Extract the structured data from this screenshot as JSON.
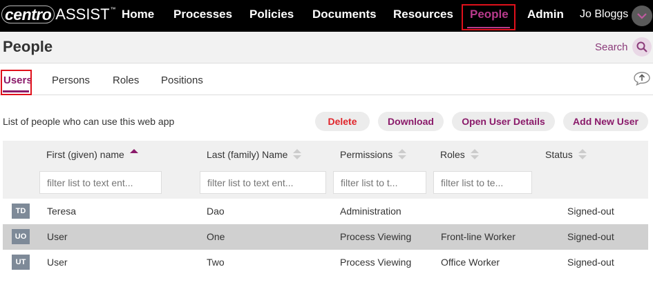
{
  "brand": {
    "logo_primary": "centro",
    "logo_secondary": "ASSIST",
    "logo_mark": "™"
  },
  "nav": {
    "items": [
      {
        "label": "Home"
      },
      {
        "label": "Processes"
      },
      {
        "label": "Policies"
      },
      {
        "label": "Documents"
      },
      {
        "label": "Resources"
      },
      {
        "label": "People"
      },
      {
        "label": "Admin"
      }
    ],
    "active": "People",
    "user_name": "Jo Bloggs",
    "user_menu_icon": "chevron-down-icon"
  },
  "header": {
    "title": "People",
    "search_label": "Search",
    "search_icon": "search-icon"
  },
  "tabs": [
    {
      "label": "Users"
    },
    {
      "label": "Persons"
    },
    {
      "label": "Roles"
    },
    {
      "label": "Positions"
    }
  ],
  "toolbar": {
    "description": "List of people who can use this web app",
    "buttons": [
      {
        "label": "Delete"
      },
      {
        "label": "Download"
      },
      {
        "label": "Open User Details"
      },
      {
        "label": "Add New User"
      }
    ]
  },
  "table": {
    "columns": [
      {
        "label": "First (given) name",
        "sort": "ascending",
        "filter_placeholder": "filter list to text ent..."
      },
      {
        "label": "Last (family) Name",
        "sort": "none",
        "filter_placeholder": "filter list to text ent..."
      },
      {
        "label": "Permissions",
        "sort": "none",
        "filter_placeholder": "filter list to t..."
      },
      {
        "label": "Roles",
        "sort": "none",
        "filter_placeholder": "filter list to te..."
      },
      {
        "label": "Status",
        "sort": "none"
      }
    ],
    "rows": [
      {
        "initials": "TD",
        "first": "Teresa",
        "last": "Dao",
        "permissions": "Administration",
        "roles": "",
        "status": "Signed-out",
        "selected": false
      },
      {
        "initials": "UO",
        "first": "User",
        "last": "One",
        "permissions": "Process Viewing",
        "roles": "Front-line Worker",
        "status": "Signed-out",
        "selected": true
      },
      {
        "initials": "UT",
        "first": "User",
        "last": "Two",
        "permissions": "Process Viewing",
        "roles": "Office Worker",
        "status": "Signed-out",
        "selected": false
      }
    ]
  },
  "colors": {
    "accent": "#8a1a6a",
    "nav_active": "#b83a8c",
    "danger": "#e0242a",
    "highlight": "#e0101b"
  }
}
